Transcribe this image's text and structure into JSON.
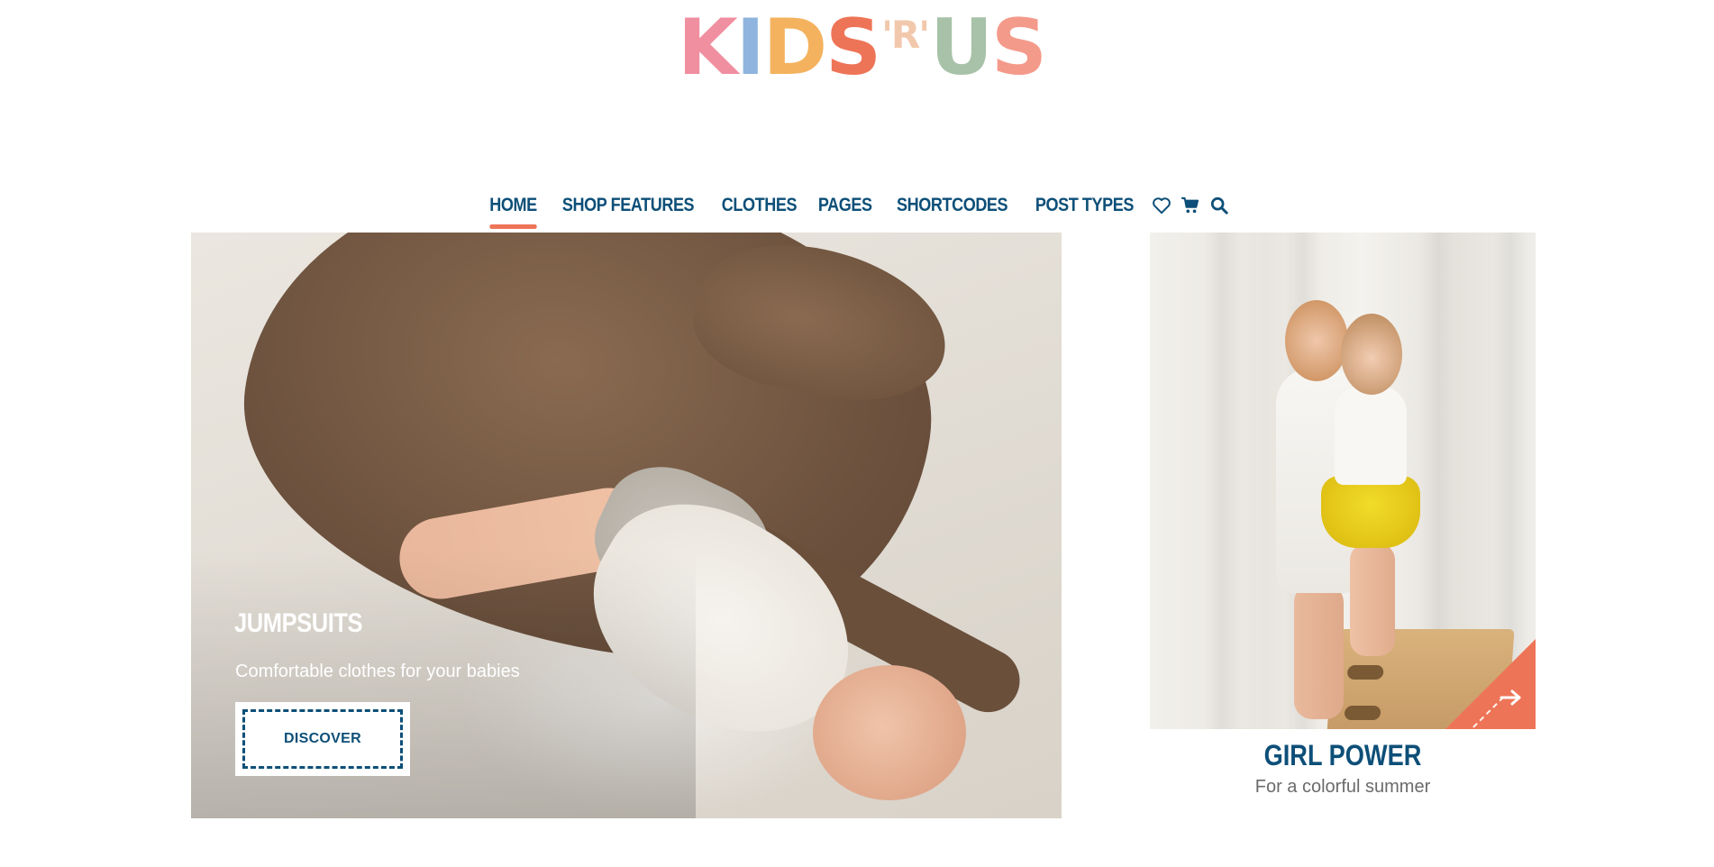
{
  "logo": {
    "letters": [
      {
        "char": "K",
        "color": "#f08fa0"
      },
      {
        "char": "I",
        "color": "#8fb4de"
      },
      {
        "char": "D",
        "color": "#f4b25e"
      },
      {
        "char": "S",
        "color": "#ee7457"
      },
      {
        "char": "'R'",
        "color": "#f2c8ac"
      },
      {
        "char": "U",
        "color": "#a7c2a8"
      },
      {
        "char": "S",
        "color": "#f49a8a"
      }
    ]
  },
  "nav": {
    "items": [
      {
        "label": "HOME",
        "active": true
      },
      {
        "label": "SHOP FEATURES",
        "active": false
      },
      {
        "label": "CLOTHES",
        "active": false
      },
      {
        "label": "PAGES",
        "active": false
      },
      {
        "label": "SHORTCODES",
        "active": false
      },
      {
        "label": "POST TYPES",
        "active": false
      }
    ],
    "icons": [
      "heart-icon",
      "cart-icon",
      "search-icon"
    ]
  },
  "hero": {
    "title": "JUMPSUITS",
    "subtitle": "Comfortable clothes for your babies",
    "button_label": "DISCOVER"
  },
  "card": {
    "title": "GIRL POWER",
    "subtitle": "For a colorful summer",
    "arrow_icon": "arrow-right-icon"
  },
  "colors": {
    "brand_blue": "#0d4f78",
    "accent_coral": "#ee7457",
    "muted_text": "#6b6b6b"
  }
}
